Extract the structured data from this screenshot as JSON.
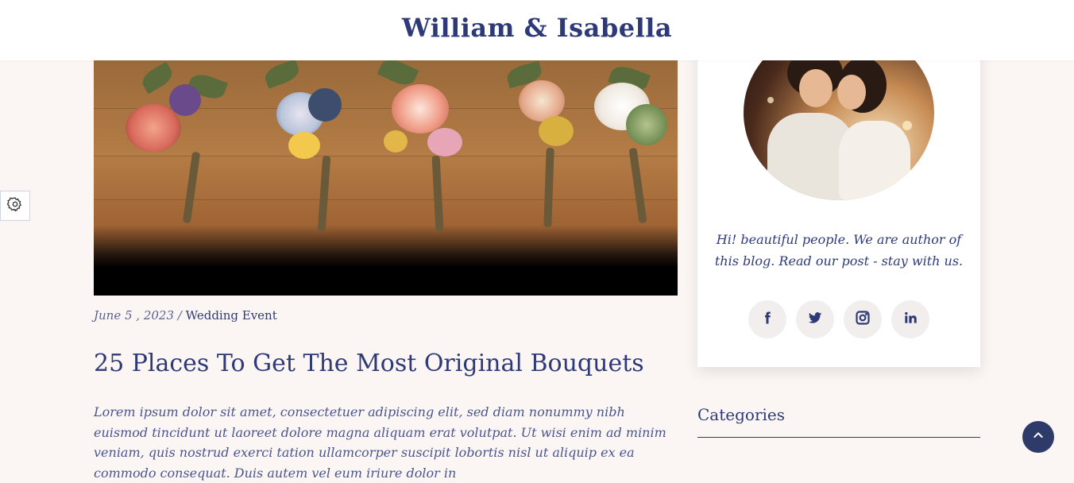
{
  "header": {
    "brand": "William & Isabella"
  },
  "hero": {
    "icon": "flower-bouquets-photo"
  },
  "post": {
    "date": "June 5 , 2023",
    "separator": "/",
    "category": "Wedding Event",
    "title": "25 Places To Get The Most Original Bouquets",
    "excerpt": "Lorem ipsum dolor sit amet, consectetuer adipiscing elit, sed diam nonummy nibh euismod tincidunt ut laoreet dolore magna aliquam erat volutpat. Ut wisi enim ad minim veniam, quis nostrud exerci tation ullamcorper suscipit lobortis nisl ut aliquip ex ea commodo consequat. Duis autem vel eum iriure dolor in"
  },
  "sidebar": {
    "bio": "Hi! beautiful people. We are author of this blog. Read our post - stay with us.",
    "socials": [
      "facebook-icon",
      "twitter-icon",
      "instagram-icon",
      "linkedin-icon"
    ],
    "categories_heading": "Categories"
  },
  "colors": {
    "accent": "#2e3a78",
    "background": "#fbf6f4",
    "to_top": "#2e3a68"
  }
}
